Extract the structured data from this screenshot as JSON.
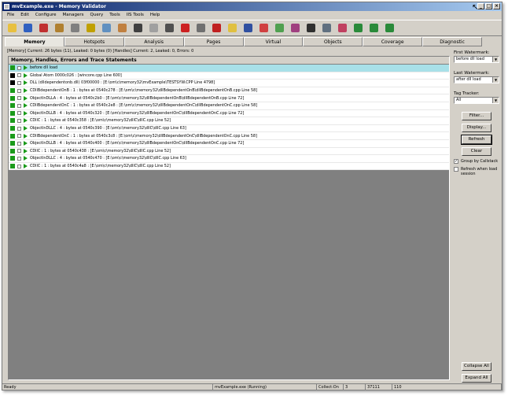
{
  "title": "mvExample.exe - Memory Validator",
  "window_buttons": [
    "_",
    "□",
    "×"
  ],
  "menu": [
    "File",
    "Edit",
    "Configure",
    "Managers",
    "Query",
    "Tools",
    "IIS Tools",
    "Help"
  ],
  "toolbar_icons": [
    {
      "name": "open-folder-icon",
      "color": "#e8c040"
    },
    {
      "name": "save-icon",
      "color": "#3060c0"
    },
    {
      "name": "launch-icon",
      "color": "#c03030"
    },
    {
      "name": "tool-4-icon",
      "color": "#b08030"
    },
    {
      "name": "tool-5-icon",
      "color": "#808080"
    },
    {
      "name": "tool-6-icon",
      "color": "#c0a000"
    },
    {
      "name": "tool-7-icon",
      "color": "#6090c0"
    },
    {
      "name": "tool-8-icon",
      "color": "#c08040"
    },
    {
      "name": "tool-9-icon",
      "color": "#404040"
    },
    {
      "name": "tool-10-icon",
      "color": "#a0a0a0"
    },
    {
      "name": "tool-11-icon",
      "color": "#505050"
    },
    {
      "name": "tool-12-icon",
      "color": "#cc2020"
    },
    {
      "name": "tool-13-icon",
      "color": "#707070"
    },
    {
      "name": "stop-icon",
      "color": "#c02020"
    },
    {
      "name": "tool-15-icon",
      "color": "#e0c040"
    },
    {
      "name": "tool-16-icon",
      "color": "#3050a0"
    },
    {
      "name": "tool-17-icon",
      "color": "#d04040"
    },
    {
      "name": "tool-18-icon",
      "color": "#50a050"
    },
    {
      "name": "tool-19-icon",
      "color": "#a04080"
    },
    {
      "name": "tool-20-icon",
      "color": "#303030"
    },
    {
      "name": "tool-21-icon",
      "color": "#607080"
    },
    {
      "name": "tool-22-icon",
      "color": "#c04060"
    },
    {
      "name": "tool-23-icon",
      "color": "#2a8a3a"
    },
    {
      "name": "tool-24-icon",
      "color": "#2a8a3a"
    },
    {
      "name": "tool-25-icon",
      "color": "#2a8a3a"
    }
  ],
  "tabs": [
    "Memory",
    "Hotspots",
    "Analysis",
    "Pages",
    "Virtual",
    "Objects",
    "Coverage",
    "Diagnostic"
  ],
  "active_tab": 0,
  "summary": "[Memory] Current: 26 bytes (11), Leaked: 0 bytes (0) [Handles] Current: 2, Leaked: 0, Errors: 0",
  "panel_title": "Memory, Handles, Errors and Trace Statements",
  "rows": [
    {
      "text": "before dll load",
      "hl": true,
      "icon": "g"
    },
    {
      "text": "Global Atom 0000c026 : [wincore.cpp Line 600]",
      "hl": false,
      "icon": "b"
    },
    {
      "text": "DLL (dlldependentonb.dll) 03f00000 : [E:\\om\\c\\memory32\\mvExample\\TESTSYW.CPP Line 4798]",
      "hl": false,
      "icon": "b"
    },
    {
      "text": "CDllBdependentOnB : 1 : bytes at 0540c278 : [E:\\om\\c\\memory32\\dllBdependentOnB\\dllBdependentOnB.cpp Line 58]",
      "hl": false,
      "icon": "g"
    },
    {
      "text": "ObjectInDLLA : 4 : bytes at 0540c2b0 : [E:\\om\\c\\memory32\\dllBdependentOnB\\dllBdependentOnB.cpp Line 72]",
      "hl": false,
      "icon": "g"
    },
    {
      "text": "CDllBdependentOnC : 1 : bytes at 0540c2e8 : [E:\\om\\c\\memory32\\dllBdependentOnC\\dllBdependentOnC.cpp Line 58]",
      "hl": false,
      "icon": "g"
    },
    {
      "text": "ObjectInDLLB : 4 : bytes at 0540c320 : [E:\\om\\c\\memory32\\dllBdependentOnC\\dllBdependentOnC.cpp Line 72]",
      "hl": false,
      "icon": "g"
    },
    {
      "text": "CDllC : 1 : bytes at 0540c358 : [E:\\om\\c\\memory32\\dllC\\dllC.cpp Line 52]",
      "hl": false,
      "icon": "g"
    },
    {
      "text": "ObjectInDLLC : 4 : bytes at 0540c390 : [E:\\om\\c\\memory32\\dllC\\dllC.cpp Line 63]",
      "hl": false,
      "icon": "g"
    },
    {
      "text": "CDllBdependentOnC : 1 : bytes at 0540c3c8 : [E:\\om\\c\\memory32\\dllBdependentOnC\\dllBdependentOnC.cpp Line 58]",
      "hl": false,
      "icon": "g"
    },
    {
      "text": "ObjectInDLLB : 4 : bytes at 0540c400 : [E:\\om\\c\\memory32\\dllBdependentOnC\\dllBdependentOnC.cpp Line 72]",
      "hl": false,
      "icon": "g"
    },
    {
      "text": "CDllC : 1 : bytes at 0540c438 : [E:\\om\\c\\memory32\\dllC\\dllC.cpp Line 52]",
      "hl": false,
      "icon": "g"
    },
    {
      "text": "ObjectInDLLC : 4 : bytes at 0540c470 : [E:\\om\\c\\memory32\\dllC\\dllC.cpp Line 63]",
      "hl": false,
      "icon": "g"
    },
    {
      "text": "CDllC : 1 : bytes at 0540c4a8 : [E:\\om\\c\\memory32\\dllC\\dllC.cpp Line 52]",
      "hl": false,
      "icon": "g"
    }
  ],
  "sidebar": {
    "first_watermark_label": "First Watermark:",
    "first_watermark_value": "before dll load",
    "last_watermark_label": "Last Watermark:",
    "last_watermark_value": "after dll load",
    "tag_tracker_label": "Tag Tracker:",
    "tag_tracker_value": "All",
    "filter_label": "Filter...",
    "display_label": "Display...",
    "refresh_label": "Refresh",
    "clear_label": "Clear",
    "group_label": "Group by Callstack",
    "group_checked": true,
    "refresh_load_label": "Refresh when load session",
    "refresh_load_checked": false,
    "collapse_label": "Collapse All",
    "expand_label": "Expand All"
  },
  "status": [
    "Ready",
    "mvExample.exe (Running)",
    "Collect:On",
    "3",
    "37111",
    "110"
  ]
}
